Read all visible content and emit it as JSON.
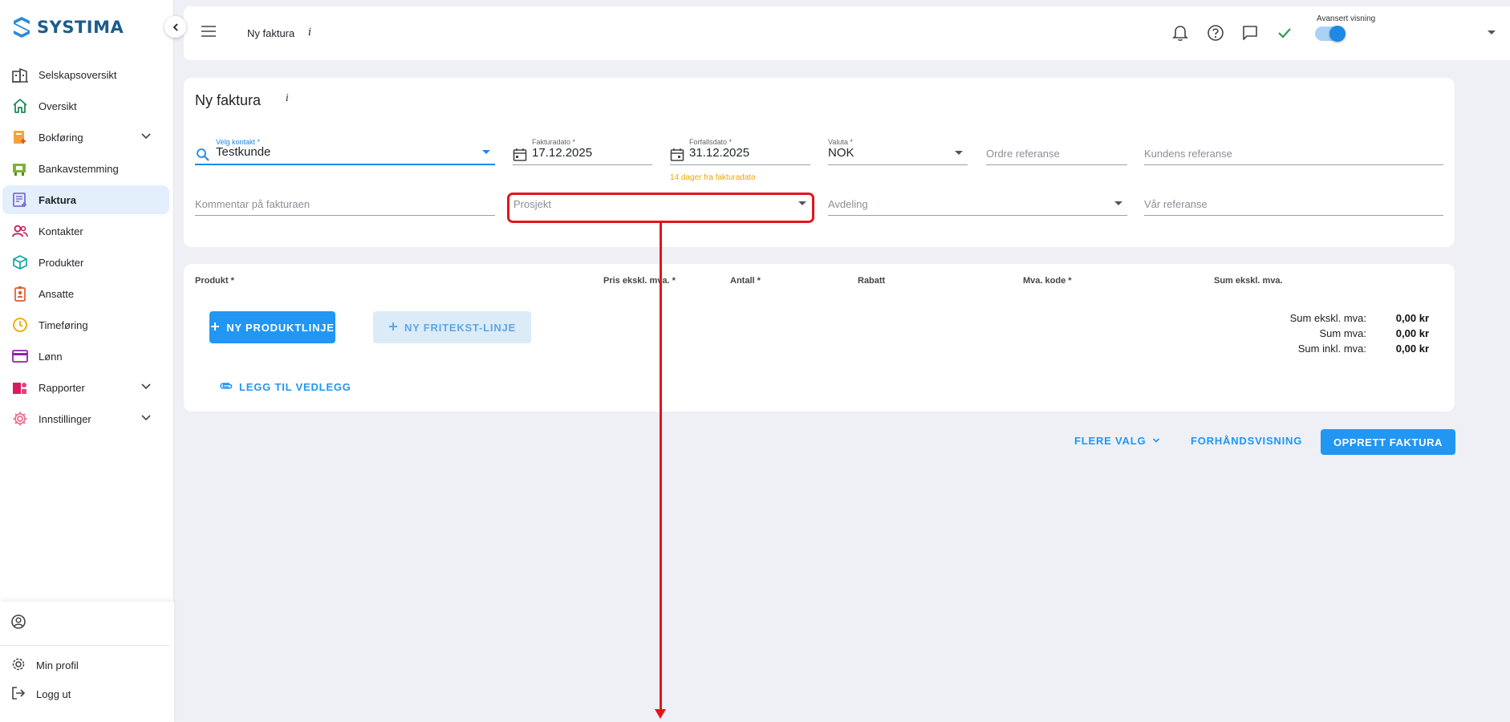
{
  "app": {
    "name": "SYSTIMA"
  },
  "sidebar": {
    "items": [
      {
        "label": "Selskapsoversikt",
        "icon": "company-building-icon",
        "expandable": false,
        "active": false
      },
      {
        "label": "Oversikt",
        "icon": "home-icon",
        "expandable": false,
        "active": false
      },
      {
        "label": "Bokføring",
        "icon": "bookkeeping-icon",
        "expandable": true,
        "active": false
      },
      {
        "label": "Bankavstemming",
        "icon": "bank-reconciliation-icon",
        "expandable": false,
        "active": false
      },
      {
        "label": "Faktura",
        "icon": "invoice-icon",
        "expandable": false,
        "active": true
      },
      {
        "label": "Kontakter",
        "icon": "contacts-icon",
        "expandable": false,
        "active": false
      },
      {
        "label": "Produkter",
        "icon": "product-box-icon",
        "expandable": false,
        "active": false
      },
      {
        "label": "Ansatte",
        "icon": "employee-badge-icon",
        "expandable": false,
        "active": false
      },
      {
        "label": "Timeføring",
        "icon": "clock-icon",
        "expandable": false,
        "active": false
      },
      {
        "label": "Lønn",
        "icon": "payroll-card-icon",
        "expandable": false,
        "active": false
      },
      {
        "label": "Rapporter",
        "icon": "reports-icon",
        "expandable": true,
        "active": false
      },
      {
        "label": "Innstillinger",
        "icon": "settings-gear-icon",
        "expandable": true,
        "active": false
      }
    ],
    "bottom": {
      "profile_label": "Min profil",
      "logout_label": "Logg ut"
    }
  },
  "topbar": {
    "title": "Ny faktura",
    "info": "i",
    "advanced_view_label": "Avansert visning",
    "advanced_view_on": true
  },
  "form": {
    "title": "Ny faktura",
    "info": "i",
    "contact": {
      "label": "Velg kontakt *",
      "value": "Testkunde"
    },
    "invoice_date": {
      "label": "Fakturadato *",
      "value": "17.12.2025"
    },
    "due_date": {
      "label": "Forfallsdato *",
      "value": "31.12.2025",
      "hint": "14 dager fra fakturadato"
    },
    "currency": {
      "label": "Valuta *",
      "value": "NOK"
    },
    "order_ref": {
      "placeholder": "Ordre referanse"
    },
    "customer_ref": {
      "placeholder": "Kundens referanse"
    },
    "comment": {
      "placeholder": "Kommentar på fakturaen"
    },
    "project": {
      "placeholder": "Prosjekt"
    },
    "department": {
      "placeholder": "Avdeling"
    },
    "our_ref": {
      "placeholder": "Vår referanse"
    }
  },
  "products": {
    "columns": [
      "Produkt *",
      "Pris ekskl. mva. *",
      "Antall *",
      "Rabatt",
      "Mva. kode *",
      "Sum ekskl. mva."
    ],
    "new_product_line": "NY PRODUKTLINJE",
    "new_freetext_line": "NY FRITEKST-LINJE",
    "add_attachment": "LEGG TIL VEDLEGG",
    "sums": [
      {
        "label": "Sum ekskl. mva:",
        "value": "0,00 kr"
      },
      {
        "label": "Sum mva:",
        "value": "0,00 kr"
      },
      {
        "label": "Sum inkl. mva:",
        "value": "0,00 kr"
      }
    ]
  },
  "actions": {
    "more_options": "FLERE VALG",
    "preview": "FORHÅNDSVISNING",
    "create_invoice": "OPPRETT FAKTURA"
  },
  "colors": {
    "primary": "#2196f3",
    "brand": "#1c5d8c",
    "annotation": "#e4141b",
    "hint": "#f0a500",
    "active_nav_bg": "#e3f0fb"
  }
}
